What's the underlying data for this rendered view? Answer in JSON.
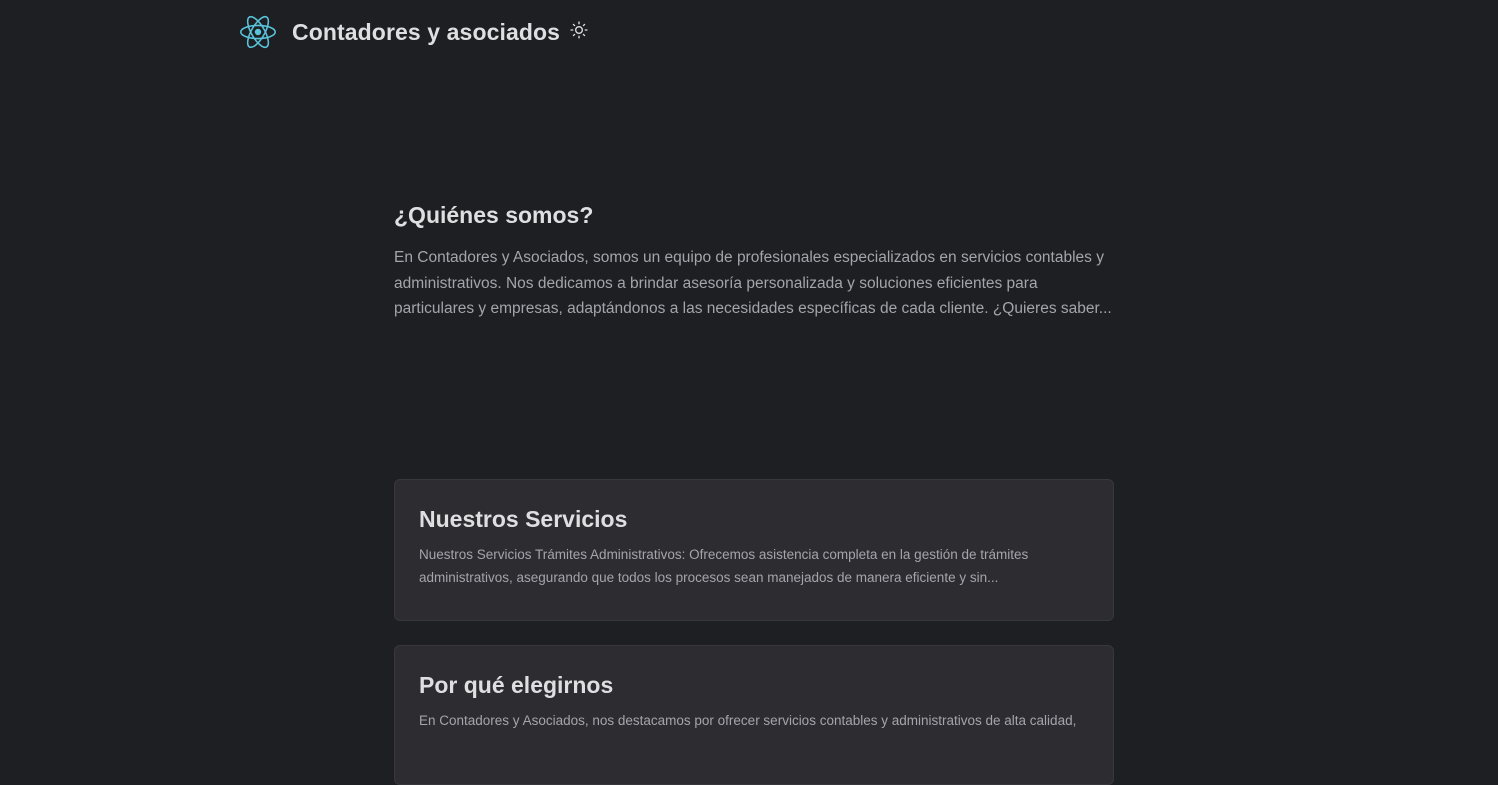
{
  "header": {
    "logo_icon": "react-atom-icon",
    "title": "Contadores y asociados",
    "theme_toggle_icon": "sun-icon"
  },
  "about": {
    "heading": "¿Quiénes somos?",
    "text": "En Contadores y Asociados, somos un equipo de profesionales especializados en servicios contables y administrativos. Nos dedicamos a brindar asesoría personalizada y soluciones eficientes para particulares y empresas, adaptándonos a las necesidades específicas de cada cliente. ¿Quieres saber..."
  },
  "cards": [
    {
      "title": "Nuestros Servicios",
      "text": "Nuestros Servicios Trámites Administrativos: Ofrecemos asistencia completa en la gestión de trámites administrativos, asegurando que todos los procesos sean manejados de manera eficiente y sin..."
    },
    {
      "title": "Por qué elegirnos",
      "text": "En Contadores y Asociados, nos destacamos por ofrecer servicios contables y administrativos de alta calidad,"
    }
  ],
  "colors": {
    "background": "#1e1f22",
    "card_background": "#2d2d31",
    "logo_accent": "#58c4dc",
    "heading": "#dfdfe2",
    "body_text": "#a4a4aa"
  }
}
